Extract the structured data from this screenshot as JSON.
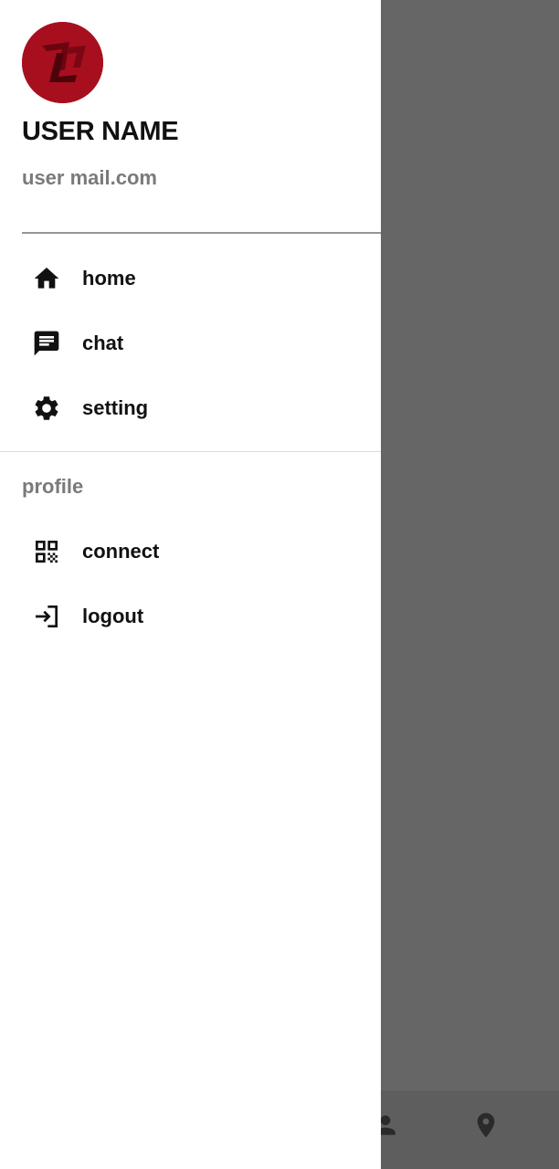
{
  "header": {
    "avatar_icon": "logo-avatar",
    "user_name": "USER NAME",
    "user_email": "user mail.com"
  },
  "menu": {
    "items": [
      {
        "label": "home",
        "icon": "home-icon"
      },
      {
        "label": "chat",
        "icon": "chat-icon"
      },
      {
        "label": "setting",
        "icon": "gear-icon"
      }
    ]
  },
  "profile_section": {
    "title": "profile",
    "items": [
      {
        "label": "connect",
        "icon": "qr-code-icon"
      },
      {
        "label": "logout",
        "icon": "logout-icon"
      }
    ]
  },
  "bottom_nav": {
    "icons": [
      "person-icon",
      "location-pin-icon"
    ]
  },
  "colors": {
    "avatar_bg": "#a70f1f",
    "scrim": "#666666",
    "text_primary": "#111111",
    "text_secondary": "#7a7a7a"
  }
}
